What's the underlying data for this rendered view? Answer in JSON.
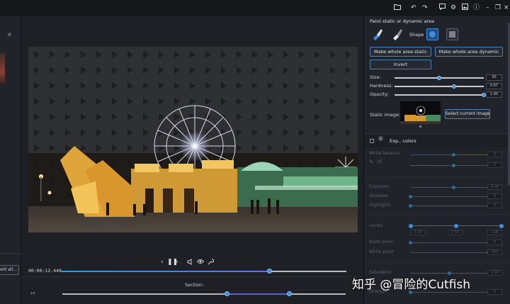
{
  "titlebar": {
    "icons": [
      "folder-icon",
      "undo-icon",
      "redo-icon",
      "feedback-icon",
      "settings-icon",
      "image-icon",
      "info-icon",
      "minimize-icon",
      "restore-icon",
      "close-icon"
    ]
  },
  "left_strip": {
    "export_label": "port all..."
  },
  "player": {
    "timecode": "00:00:12.440",
    "position_fraction": 0.73,
    "section_label": "Section:",
    "section_start_fraction": 0.58,
    "section_end_fraction": 0.8
  },
  "panel": {
    "title": "Paint static or dynamic area",
    "shape_label": "Shape",
    "buttons": {
      "make_static": "Make whole area static",
      "make_dynamic": "Make whole area dynamic",
      "invert": "Invert",
      "select_current": "Select current image"
    },
    "size": {
      "label": "Size:",
      "value": "30",
      "fraction": 0.5
    },
    "hardness": {
      "label": "Hardness:",
      "value": "0.67",
      "fraction": 0.67
    },
    "opacity": {
      "label": "Opacity:",
      "value": "1.00",
      "fraction": 1.0
    },
    "static_image_label": "Static image:",
    "static_image_caption": "ø",
    "exp_section": {
      "title": "Exp., colors",
      "white_balance": "White balance",
      "exposure": "Exposure",
      "shadows": "Shadows",
      "highlights": "Highlights",
      "levels": "Levels",
      "levels_values": [
        "0.00",
        "0.50",
        "1.00"
      ],
      "black_point": "Black point",
      "white_point": "White point",
      "saturation": "Saturation",
      "strength": "Strength",
      "exposure_value": "0.00",
      "zero_value": "0",
      "wb_value_1": "0",
      "wb_value_2": "0",
      "black_value": "0",
      "white_value": "255",
      "sat_value": "1.00",
      "strength_value": "0"
    }
  },
  "watermark": "知乎 @冒险的Cutfish",
  "colors": {
    "accent": "#3d8fda",
    "panel_bg": "#202329",
    "background": "#1a1c21"
  }
}
